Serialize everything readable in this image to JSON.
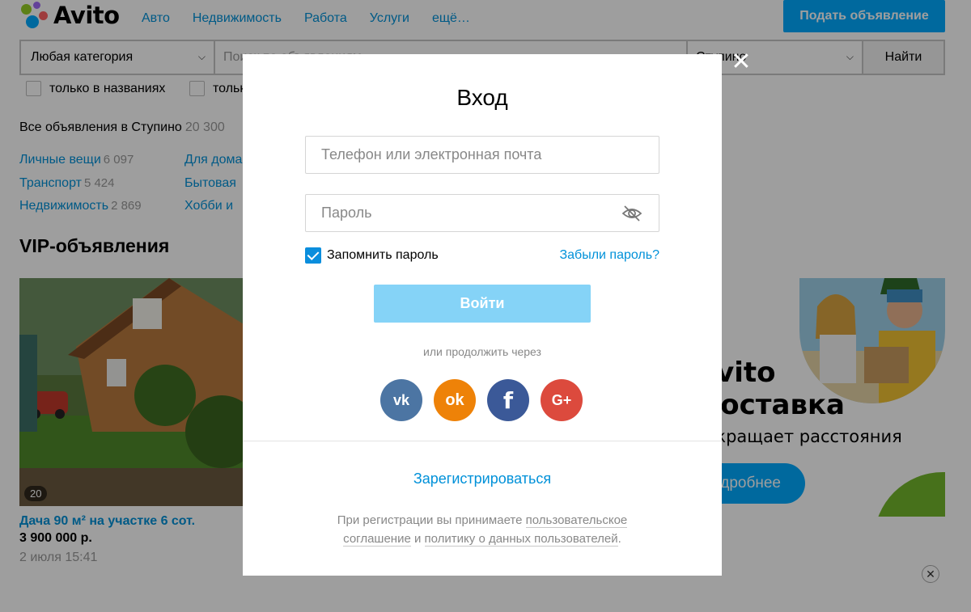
{
  "header": {
    "logo_text": "Avito",
    "nav": [
      "Авто",
      "Недвижимость",
      "Работа",
      "Услуги",
      "ещё…"
    ],
    "post_button": "Подать объявление"
  },
  "search": {
    "category": "Любая категория",
    "placeholder": "Поиск по объявлениям",
    "city": "Ступино",
    "find_button": "Найти",
    "checkbox1": "только в названиях",
    "checkbox2": "только с фото"
  },
  "summary": {
    "label": "Все объявления в Ступино",
    "count": "20 300"
  },
  "categories": {
    "col1": [
      {
        "label": "Личные вещи",
        "count": "6 097"
      },
      {
        "label": "Транспорт",
        "count": "5 424"
      },
      {
        "label": "Недвижимость",
        "count": "2 869"
      }
    ],
    "col2": [
      {
        "label": "Для дома"
      },
      {
        "label": "Бытовая"
      },
      {
        "label": "Хобби и"
      }
    ]
  },
  "vip": {
    "title": "VIP-объявления",
    "listing": {
      "photo_count": "20",
      "title": "Дача 90 м² на участке 6 сот.",
      "price": "3 900 000 р.",
      "date": "2 июля 15:41"
    }
  },
  "promo": {
    "line1": "Avito",
    "line2": "Доставка",
    "subtitle": "сокращает расстояния",
    "button": "Подробнее"
  },
  "modal": {
    "title": "Вход",
    "login_placeholder": "Телефон или электронная почта",
    "password_placeholder": "Пароль",
    "remember_label": "Запомнить пароль",
    "forgot_link": "Забыли пароль?",
    "login_button": "Войти",
    "or_text": "или продолжить через",
    "social": {
      "vk": "vk",
      "ok": "ok",
      "fb": "f",
      "gp": "G+"
    },
    "register_link": "Зарегистрироваться",
    "terms": {
      "pre": "При регистрации вы принимаете ",
      "link1": "пользовательское соглашение",
      "mid": " и ",
      "link2": "политику о данных пользователей",
      "post": "."
    }
  },
  "colors": {
    "accent": "#00aaff",
    "link": "#0091d9",
    "login_disabled": "#85d3f7",
    "vk": "#4c75a3",
    "ok": "#ee8208",
    "facebook": "#3b5998",
    "google_plus": "#dc4a3d"
  }
}
